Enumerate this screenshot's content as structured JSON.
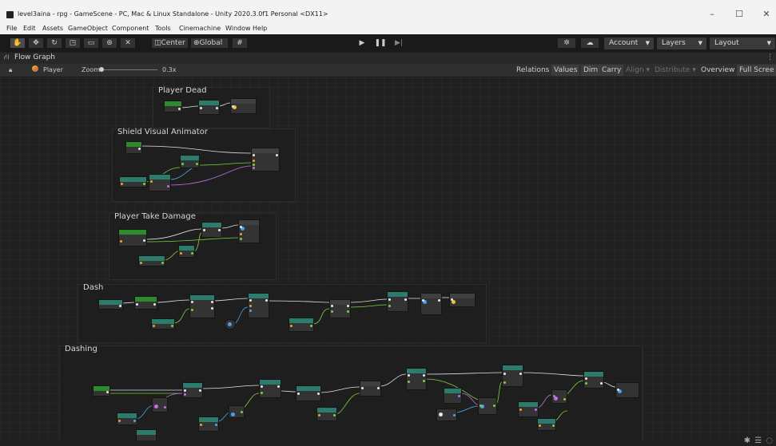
{
  "window": {
    "title": "level3aina - rpg - GameScene - PC, Mac & Linux Standalone - Unity 2020.3.0f1 Personal <DX11>",
    "controls": {
      "minimize": "–",
      "maximize": "☐",
      "close": "✕"
    }
  },
  "menu": [
    "File",
    "Edit",
    "Assets",
    "GameObject",
    "Component",
    "Tools",
    "Cinemachine",
    "Window",
    "Help"
  ],
  "toolbar": {
    "pivot_label": "Center",
    "space_label": "Global",
    "account_label": "Account",
    "layers_label": "Layers",
    "layout_label": "Layout"
  },
  "graph_window": {
    "title": "Flow Graph",
    "object_label": "Player",
    "zoom_label": "Zoom",
    "zoom_value": "0.3x",
    "zoom_fraction": 0.0,
    "buttons": {
      "relations": "Relations",
      "values": "Values",
      "dim": "Dim",
      "carry": "Carry",
      "align": "Align",
      "distribute": "Distribute",
      "overview": "Overview",
      "fullscreen": "Full Scree"
    }
  },
  "groups": {
    "player_dead": "Player Dead",
    "shield_visual_animator": "Shield Visual Animator",
    "player_take_damage": "Player Take Damage",
    "dash": "Dash",
    "dashing": "Dashing"
  },
  "colors": {
    "event_node": "#2e8a2e",
    "unit_node": "#2c7b6c",
    "flow_wire": "#e0e0e0",
    "float_wire": "#7dd03e",
    "object_wire": "#c070e0",
    "int_wire": "#4aa8e8"
  }
}
